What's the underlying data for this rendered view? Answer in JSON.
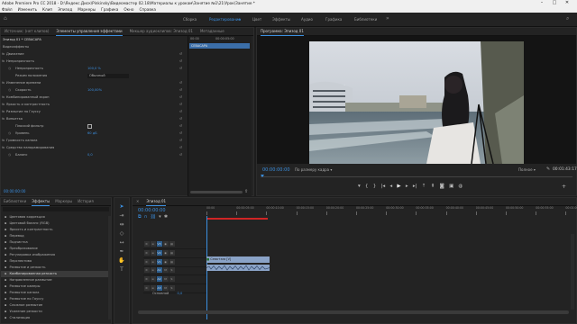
{
  "window": {
    "title": "Adobe Premiere Pro CC 2018 - D:\\Яндекс.Диск\\Pinkinsky\\Видеомастер 02.18\\Материалы к урокам\\Занятие №1\\21\\Урок\\Занятие *"
  },
  "menu": [
    "Файл",
    "Изменить",
    "Клип",
    "Эпизод",
    "Маркеры",
    "Графика",
    "Окно",
    "Справка"
  ],
  "workspaces": [
    "Сборка",
    "Редактирование",
    "Цвет",
    "Эффекты",
    "Аудио",
    "Графика",
    "Библиотеки"
  ],
  "workspace_active": "Редактирование",
  "effect_controls": {
    "tabs": [
      "Источник: (нет клипов)",
      "Элементы управления эффектами",
      "Микшер аудиоклипов: Эпизод 01",
      "Метаданные"
    ],
    "active_tab": "Элементы управления эффектами",
    "clip_path": "Эпизод 01 * СЕВАСАРА",
    "mini_timeline_start": "00:00",
    "mini_timeline_end": "00:00:05:00",
    "mini_clip": "СЕВАСАРА",
    "timecode": "00:00:00:00",
    "rows": [
      {
        "label": "Видеоэффекты",
        "value": "",
        "kind": "header"
      },
      {
        "label": "Движение",
        "value": "",
        "kind": "fx"
      },
      {
        "label": "Непрозрачность",
        "value": "",
        "kind": "fx"
      },
      {
        "label": "Непрозрачность",
        "value": "100,0 %",
        "kind": "param"
      },
      {
        "label": "Режим наложения",
        "value": "Обычный",
        "kind": "dropdown"
      },
      {
        "label": "Изменение времени",
        "value": "",
        "kind": "fx"
      },
      {
        "label": "Скорость",
        "value": "100,00%",
        "kind": "param"
      },
      {
        "label": "Комбинированный экран",
        "value": "",
        "kind": "fx"
      },
      {
        "label": "Яркость и контрастность",
        "value": "",
        "kind": "fx"
      },
      {
        "label": "Размытие по Гауссу",
        "value": "",
        "kind": "fx"
      },
      {
        "label": "Виньетка",
        "value": "",
        "kind": "fx"
      },
      {
        "label": "Плоский фильтр",
        "value": "",
        "kind": "check"
      },
      {
        "label": "Уровень",
        "value": "60 дБ",
        "kind": "param"
      },
      {
        "label": "Громкость канала",
        "value": "",
        "kind": "fx"
      },
      {
        "label": "Средство панорамирования",
        "value": "",
        "kind": "fx"
      },
      {
        "label": "Баланс",
        "value": "0,0",
        "kind": "param"
      }
    ]
  },
  "program_monitor": {
    "title": "Программа: Эпизод 01",
    "timecode": "00:00:00:00",
    "fit": "По размеру кадра",
    "quality": "Полное",
    "duration": "00:01:43:17"
  },
  "project": {
    "tabs": [
      "Библиотеки",
      "Эффекты",
      "Маркеры",
      "История"
    ],
    "active_tab": "Эффекты",
    "items": [
      "Цветовая коррекция",
      "Цветовой баланс (RGB)",
      "Яркость и контрастность",
      "Перевод",
      "Подчистка",
      "Преобразование",
      "Регулировка изображения",
      "Перспектива",
      "Размытие и резкость",
      "Комбинированная резкость",
      "Направленное размытие",
      "Размытие камеры",
      "Размытие канала",
      "Размытие по Гауссу",
      "Сложное размытие",
      "Усиление резкости",
      "Стилизация"
    ],
    "selected": "Комбинированная резкость"
  },
  "timeline": {
    "tab": "Эпизод 01",
    "timecode": "00:00:00:00",
    "ruler": [
      "00:00",
      "00:00:05:00",
      "00:00:10:00",
      "00:00:15:00",
      "00:00:20:00",
      "00:00:25:00",
      "00:00:30:00",
      "00:00:35:00",
      "00:00:40:00",
      "00:00:45:00",
      "00:00:50:00",
      "00:00:55:00",
      "00:01:00:00"
    ],
    "video_tracks": [
      "V3",
      "V2",
      "V1"
    ],
    "audio_tracks": [
      "A1",
      "A2",
      "A3"
    ],
    "master": "Основной",
    "master_value": "0,0",
    "video_clip": "Сева+ara [V]",
    "audio_clip": ""
  },
  "tools": [
    "selection-tool",
    "track-select-tool",
    "ripple-edit-tool",
    "razor-tool",
    "slip-tool",
    "pen-tool",
    "hand-tool",
    "type-tool"
  ],
  "colors": {
    "accent": "#3b8fe0",
    "panel": "#232323",
    "bg": "#1d1d1d",
    "clip_video": "#8aa3c7",
    "clip_audio": "#4b9a6d"
  }
}
